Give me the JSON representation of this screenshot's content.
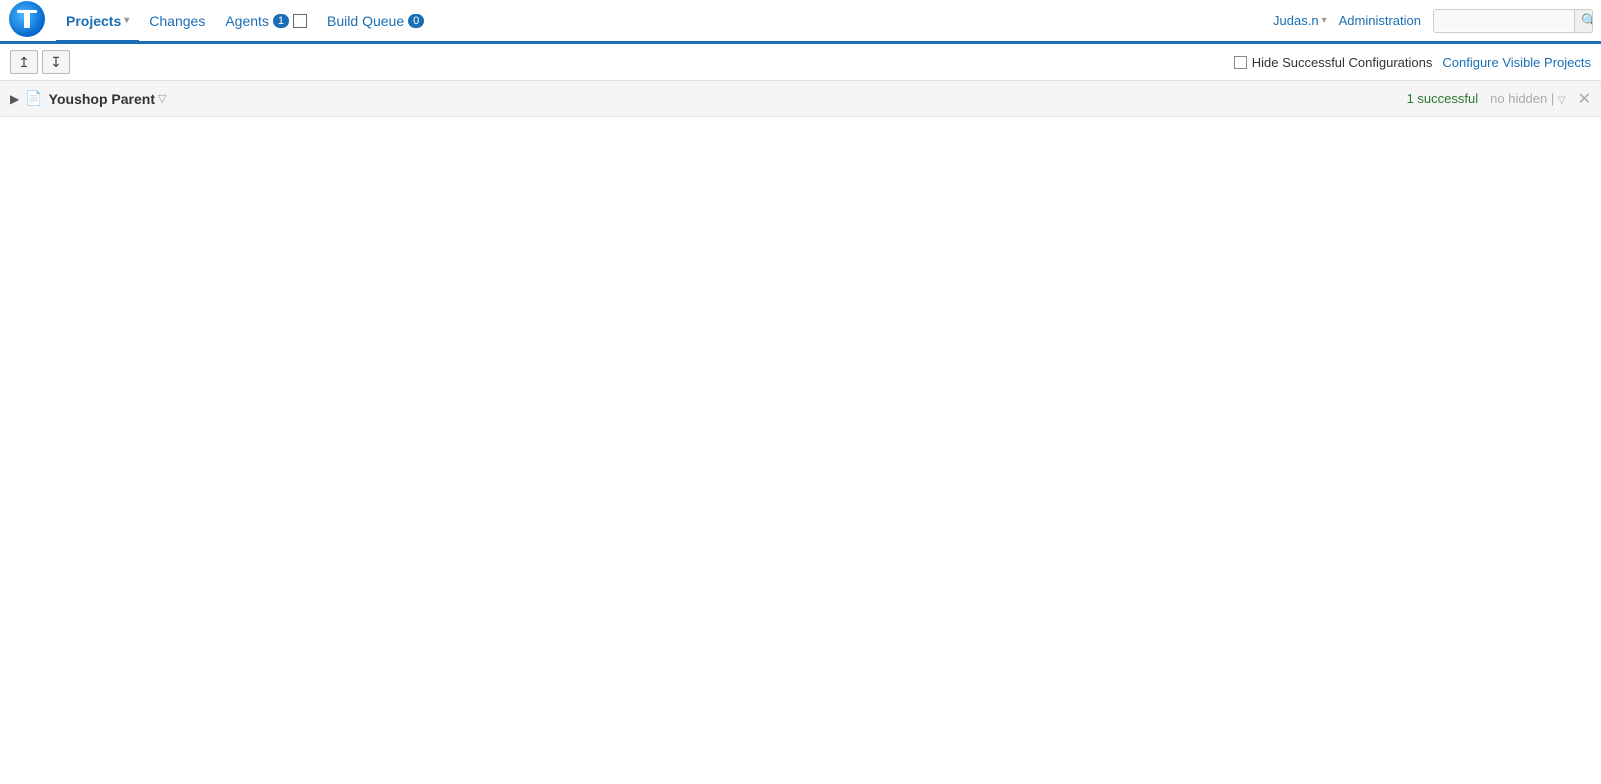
{
  "header": {
    "logo_alt": "TeamCity",
    "nav": [
      {
        "id": "projects",
        "label": "Projects",
        "active": true,
        "has_dropdown": true,
        "badge": null,
        "indicator": false
      },
      {
        "id": "changes",
        "label": "Changes",
        "active": false,
        "has_dropdown": false,
        "badge": null,
        "indicator": false
      },
      {
        "id": "agents",
        "label": "Agents",
        "active": false,
        "has_dropdown": false,
        "badge": "1",
        "indicator": true
      },
      {
        "id": "build-queue",
        "label": "Build Queue",
        "active": false,
        "has_dropdown": false,
        "badge": "0",
        "indicator": false
      }
    ],
    "user": "Judas.n",
    "user_dropdown": true,
    "admin_label": "Administration",
    "search_placeholder": ""
  },
  "toolbar": {
    "expand_all_title": "Expand all",
    "collapse_all_title": "Collapse all",
    "hide_successful_label": "Hide Successful Configurations",
    "configure_visible_label": "Configure Visible Projects"
  },
  "projects": [
    {
      "id": "youshop-parent",
      "name": "Youshop Parent",
      "has_dropdown": true,
      "status": "1 successful",
      "hidden": "no hidden",
      "has_pipe": true
    }
  ]
}
